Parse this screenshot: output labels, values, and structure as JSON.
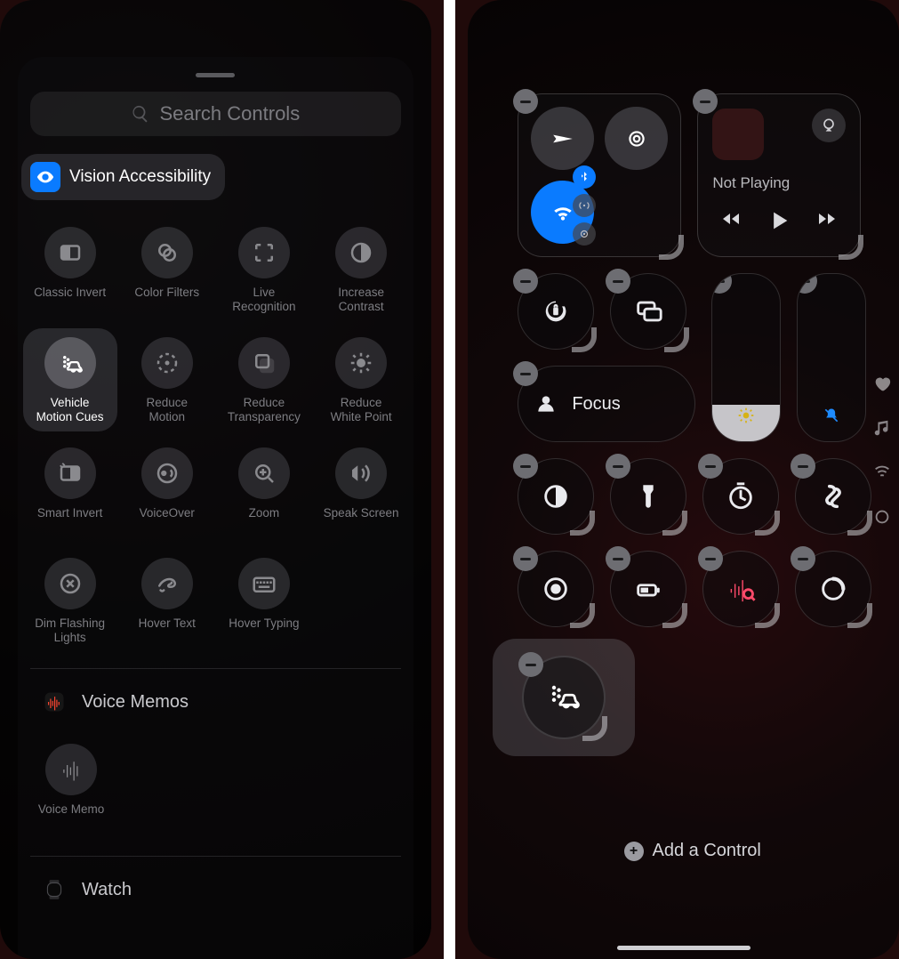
{
  "left": {
    "search_placeholder": "Search Controls",
    "section_title": "Vision Accessibility",
    "tiles": [
      {
        "label": "Classic Invert"
      },
      {
        "label": "Color Filters"
      },
      {
        "label": "Live\nRecognition"
      },
      {
        "label": "Increase\nContrast"
      },
      {
        "label": "Vehicle\nMotion Cues",
        "selected": true
      },
      {
        "label": "Reduce\nMotion"
      },
      {
        "label": "Reduce\nTransparency"
      },
      {
        "label": "Reduce\nWhite Point"
      },
      {
        "label": "Smart Invert"
      },
      {
        "label": "VoiceOver"
      },
      {
        "label": "Zoom"
      },
      {
        "label": "Speak Screen"
      },
      {
        "label": "Dim Flashing\nLights"
      },
      {
        "label": "Hover Text"
      },
      {
        "label": "Hover Typing"
      }
    ],
    "voice_memos_section": "Voice Memos",
    "voice_memo_tile": "Voice Memo",
    "watch_section": "Watch"
  },
  "right": {
    "not_playing": "Not Playing",
    "focus_label": "Focus",
    "add_control": "Add a Control",
    "selected_tile_name": "Vehicle Motion Cues"
  }
}
